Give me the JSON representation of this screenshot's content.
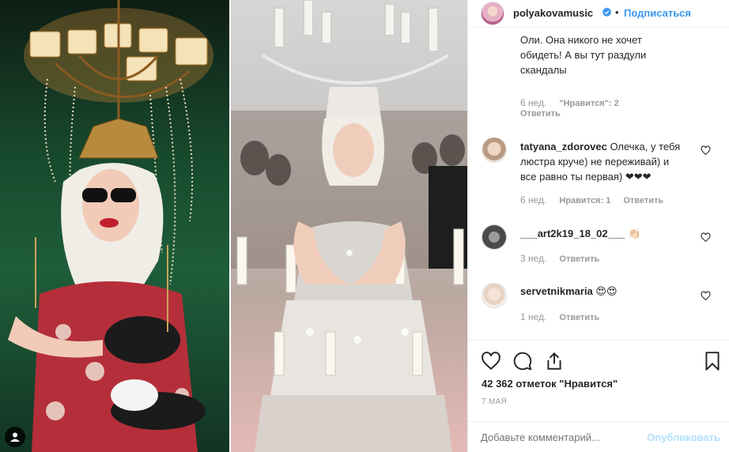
{
  "post": {
    "username": "polyakovamusic",
    "follow_label": "Подписаться",
    "separator": "•",
    "verified_icon": "verified-badge-icon",
    "tag_icon": "user-tag-icon"
  },
  "comments": [
    {
      "text_lines": [
        "Оли. Она никого не хочет",
        "обидеть! А вы тут раздули",
        "скандалы"
      ],
      "time": "6 нед.",
      "likes": "\"Нравится\": 2",
      "reply": "Ответить"
    },
    {
      "username": "tatyana_zdorovec",
      "text_first": "Олечка, у тебя",
      "text_lines": [
        "люстра круче) не переживай) и",
        "все равно ты первая) ❤❤❤"
      ],
      "time": "6 нед.",
      "likes": "Нравится: 1",
      "reply": "Ответить"
    },
    {
      "username": "___art2k19_18_02___",
      "text": "👏🏻",
      "time": "3 нед.",
      "reply": "Ответить"
    },
    {
      "username": "servetnikmaria",
      "text": "😍😍",
      "time": "1 нед.",
      "reply": "Ответить"
    }
  ],
  "actions": {
    "like_icon": "heart-icon",
    "comment_icon": "comment-icon",
    "share_icon": "share-icon",
    "save_icon": "bookmark-icon",
    "likes_count": "42 362 отметок \"Нравится\"",
    "date": "7 мая"
  },
  "add_comment": {
    "placeholder": "Добавьте комментарий...",
    "post_label": "Опубликовать"
  },
  "colors": {
    "accent": "#3897f0",
    "heart_red": "#c0151b",
    "post_disabled": "#b2dffc"
  }
}
